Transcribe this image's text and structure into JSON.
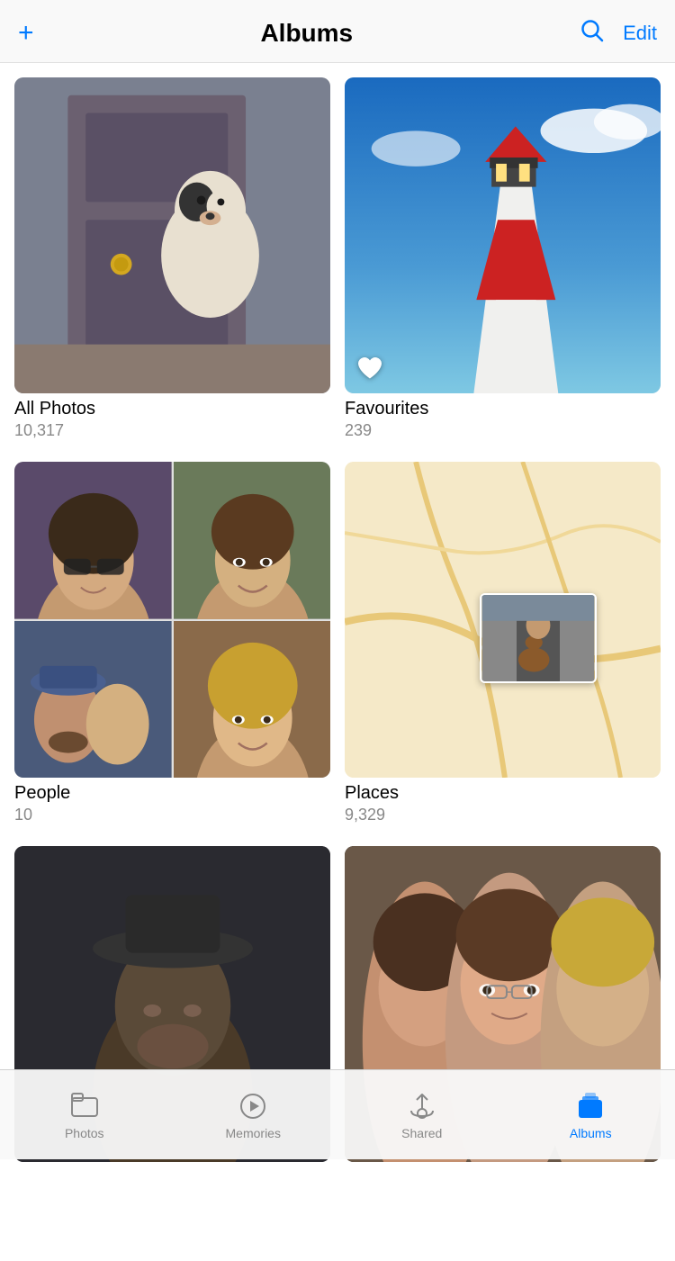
{
  "header": {
    "title": "Albums",
    "add_label": "+",
    "edit_label": "Edit"
  },
  "albums": [
    {
      "id": "all-photos",
      "name": "All Photos",
      "count": "10,317",
      "type": "single",
      "has_heart": false,
      "thumb_color": "#7a7a8a"
    },
    {
      "id": "favourites",
      "name": "Favourites",
      "count": "239",
      "type": "single",
      "has_heart": true,
      "thumb_color": "#3a6fa0"
    },
    {
      "id": "people",
      "name": "People",
      "count": "10",
      "type": "people",
      "has_heart": false
    },
    {
      "id": "places",
      "name": "Places",
      "count": "9,329",
      "type": "places",
      "has_heart": false
    },
    {
      "id": "album5",
      "name": "",
      "count": "",
      "type": "partial",
      "thumb_color": "#333344"
    },
    {
      "id": "album6",
      "name": "",
      "count": "",
      "type": "partial",
      "thumb_color": "#5a4040"
    }
  ],
  "bottom_nav": {
    "items": [
      {
        "id": "photos",
        "label": "Photos",
        "active": false
      },
      {
        "id": "memories",
        "label": "Memories",
        "active": false
      },
      {
        "id": "shared",
        "label": "Shared",
        "active": false
      },
      {
        "id": "albums",
        "label": "Albums",
        "active": true
      }
    ]
  },
  "colors": {
    "active_blue": "#007aff",
    "inactive_gray": "#888888"
  }
}
